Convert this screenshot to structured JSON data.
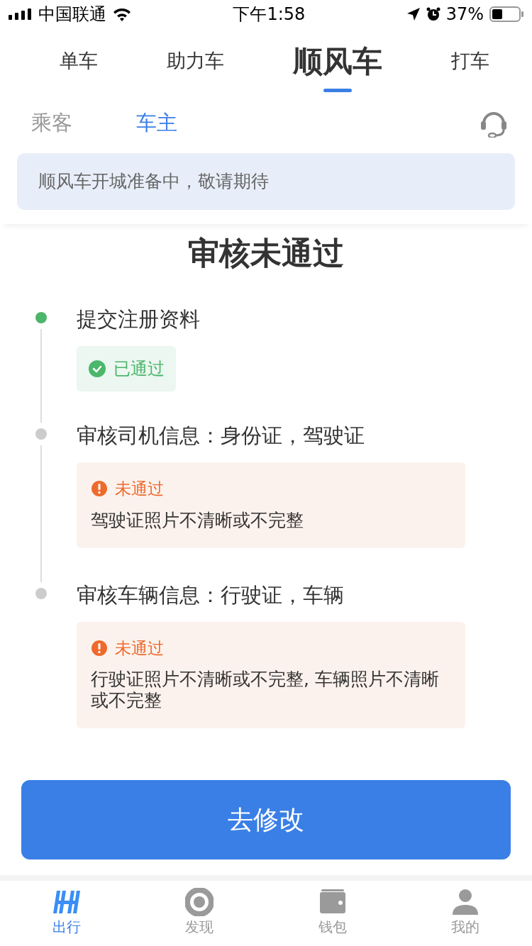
{
  "status_bar": {
    "carrier": "中国联通",
    "time": "下午1:58",
    "battery": "37%"
  },
  "top_tabs": [
    {
      "label": "单车",
      "selected": false
    },
    {
      "label": "助力车",
      "selected": false
    },
    {
      "label": "顺风车",
      "selected": true
    },
    {
      "label": "打车",
      "selected": false
    }
  ],
  "role_tabs": [
    {
      "label": "乘客",
      "selected": false
    },
    {
      "label": "车主",
      "selected": true
    }
  ],
  "notice": "顺风车开城准备中，敬请期待",
  "title": "审核未通过",
  "steps": [
    {
      "title": "提交注册资料",
      "done": true,
      "result": {
        "kind": "passed",
        "label": "已通过"
      }
    },
    {
      "title": "审核司机信息：身份证，驾驶证",
      "done": false,
      "result": {
        "kind": "failed",
        "label": "未通过",
        "reason": "驾驶证照片不清晰或不完整"
      }
    },
    {
      "title": "审核车辆信息：行驶证，车辆",
      "done": false,
      "result": {
        "kind": "failed",
        "label": "未通过",
        "reason": "行驶证照片不清晰或不完整, 车辆照片不清晰或不完整"
      }
    }
  ],
  "action_button": "去修改",
  "bottom_nav": [
    {
      "label": "出行",
      "kind": "ride",
      "selected": true
    },
    {
      "label": "发现",
      "kind": "discover",
      "selected": false
    },
    {
      "label": "钱包",
      "kind": "wallet",
      "selected": false
    },
    {
      "label": "我的",
      "kind": "profile",
      "selected": false
    }
  ]
}
